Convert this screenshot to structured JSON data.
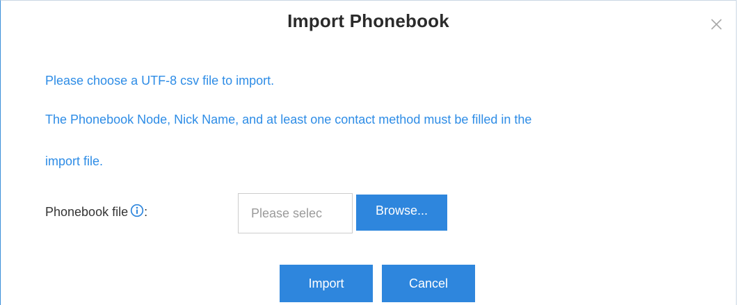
{
  "dialog": {
    "title": "Import Phonebook",
    "close_icon": "close-icon",
    "messages": [
      "Please choose a UTF-8 csv file to import.",
      "The Phonebook Node, Nick Name, and at least one contact method must be filled in the",
      "import file."
    ],
    "field": {
      "label": "Phonebook file",
      "label_suffix": ":",
      "info_icon": "info-icon",
      "placeholder": "Please selec",
      "browse_label": "Browse..."
    },
    "buttons": {
      "import_label": "Import",
      "cancel_label": "Cancel"
    }
  },
  "colors": {
    "accent": "#2e86dd",
    "message_text": "#2d8ce6",
    "title_text": "#2b2b2b"
  }
}
